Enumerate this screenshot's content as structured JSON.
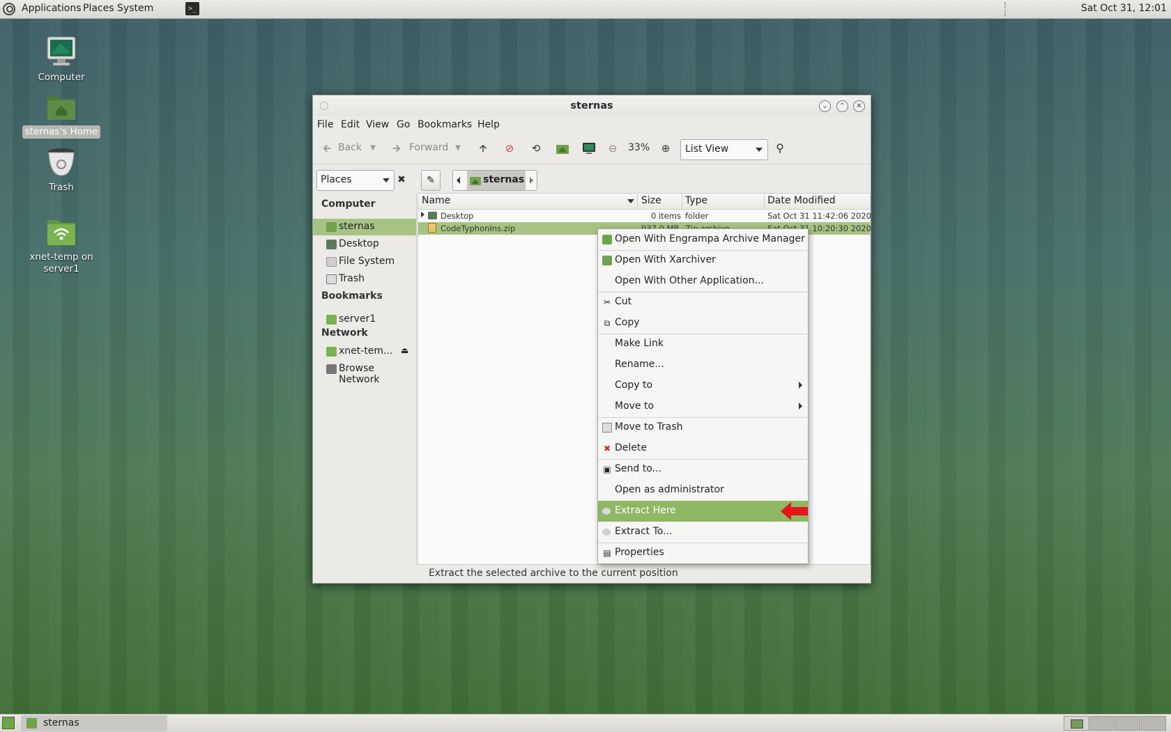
{
  "top_panel": {
    "menus": [
      "Applications",
      "Places",
      "System"
    ],
    "clock": "Sat Oct 31, 12:01"
  },
  "desktop": {
    "icons": [
      {
        "label": "Computer",
        "icon": "computer-icon"
      },
      {
        "label": "sternas's Home",
        "icon": "home-folder-icon"
      },
      {
        "label": "Trash",
        "icon": "trash-icon"
      },
      {
        "label": "xnet-temp on server1",
        "icon": "network-share-icon"
      }
    ]
  },
  "window": {
    "title": "sternas",
    "menus": [
      "File",
      "Edit",
      "View",
      "Go",
      "Bookmarks",
      "Help"
    ],
    "toolbar": {
      "back": "Back",
      "forward": "Forward",
      "zoom": "33%",
      "view_mode": "List View"
    },
    "location": {
      "places_selector": "Places",
      "crumb": "sternas"
    },
    "sidebar": {
      "computer_heading": "Computer",
      "computer_items": [
        "sternas",
        "Desktop",
        "File System",
        "Trash"
      ],
      "bookmarks_heading": "Bookmarks",
      "bookmark_items": [
        "server1"
      ],
      "network_heading": "Network",
      "network_items": [
        "xnet-tem...",
        "Browse Network"
      ]
    },
    "columns": [
      "Name",
      "Size",
      "Type",
      "Date Modified"
    ],
    "files": [
      {
        "name": "Desktop",
        "size": "0 items",
        "type": "folder",
        "modified": "Sat Oct 31 11:42:06 2020"
      },
      {
        "name": "CodeTyphonIns.zip",
        "size": "937.0 MB",
        "type": "Zip archive",
        "modified": "Sat Oct 31 10:20:30 2020"
      }
    ],
    "status": "Extract the selected archive to the current position"
  },
  "context_menu": {
    "items": [
      {
        "label": "Open With Engrampa Archive Manager",
        "icon": "archive-manager-icon"
      },
      {
        "label": "Open With Xarchiver",
        "icon": "xarchiver-icon"
      },
      {
        "label": "Open With Other Application...",
        "icon": ""
      },
      {
        "label": "Cut",
        "icon": "scissors-icon"
      },
      {
        "label": "Copy",
        "icon": "copy-icon"
      },
      {
        "label": "Make Link",
        "icon": ""
      },
      {
        "label": "Rename...",
        "icon": ""
      },
      {
        "label": "Copy to",
        "icon": ""
      },
      {
        "label": "Move to",
        "icon": ""
      },
      {
        "label": "Move to Trash",
        "icon": "trash-icon"
      },
      {
        "label": "Delete",
        "icon": "delete-icon"
      },
      {
        "label": "Send to...",
        "icon": "send-icon"
      },
      {
        "label": "Open as administrator",
        "icon": ""
      },
      {
        "label": "Extract Here",
        "icon": "extract-icon"
      },
      {
        "label": "Extract To...",
        "icon": "extract-icon"
      },
      {
        "label": "Properties",
        "icon": "properties-icon"
      }
    ],
    "highlighted": "Extract Here"
  },
  "taskbar": {
    "task_label": "sternas"
  },
  "colors": {
    "accent": "#a7c383",
    "menu_highlight": "#8fb764",
    "annotation_arrow": "#e3161b"
  }
}
